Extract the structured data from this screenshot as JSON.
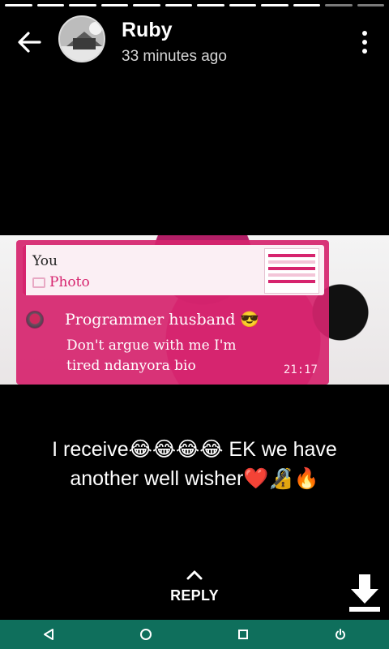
{
  "status": {
    "segments_total": 12,
    "segments_viewed": 10
  },
  "header": {
    "name": "Ruby",
    "time": "33 minutes ago",
    "icons": {
      "back": "arrow-back-icon",
      "menu": "more-vert-icon"
    }
  },
  "story_image": {
    "quote": {
      "author": "You",
      "label": "Photo"
    },
    "message": {
      "line1": "Programmer husband 😎",
      "line2": "Don't argue with me I'm tired ndanyora bio",
      "time": "21:17"
    }
  },
  "caption": "I receive😂😂😂😂 EK we have another well wisher❤️🔏🔥",
  "reply": {
    "label": "REPLY"
  },
  "navbar": {
    "items": [
      "back-triangle-icon",
      "home-circle-icon",
      "recents-square-icon",
      "power-icon"
    ]
  },
  "colors": {
    "nav_bar": "#0f6f5c",
    "accent_pink": "#d6246e"
  }
}
